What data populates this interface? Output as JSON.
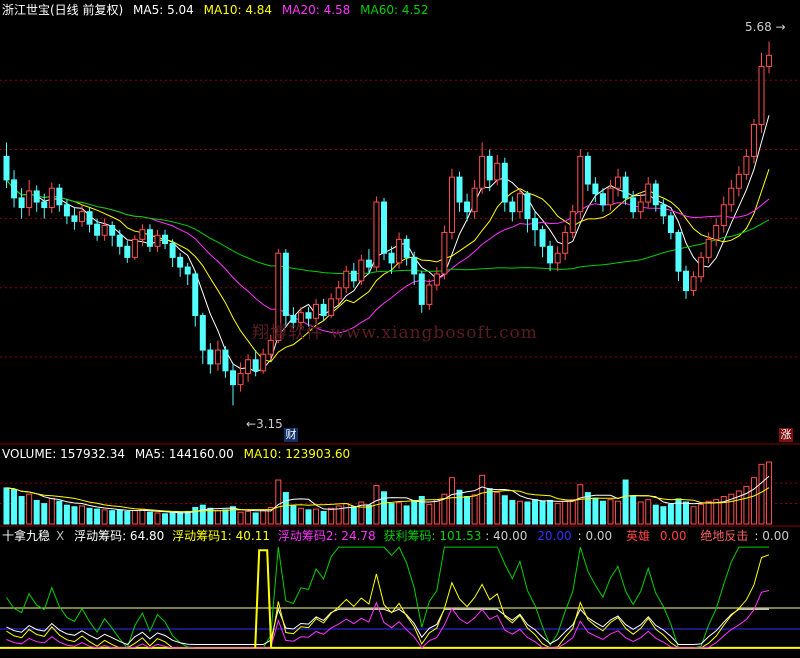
{
  "main_header": {
    "title": "浙江世宝(日线 前复权)",
    "ma5_label": "MA5: 5.04",
    "ma10_label": "MA10: 4.84",
    "ma20_label": "MA20: 4.58",
    "ma60_label": "MA60: 4.52"
  },
  "price_panel": {
    "high_marker": "5.68",
    "low_marker": "3.15",
    "finance_badge": "财",
    "rise_badge": "涨",
    "watermark": "翔博软件 www.xiangbosoft.com"
  },
  "volume_header": {
    "volume_label": "VOLUME: 157932.34",
    "ma5_label": "MA5: 144160.00",
    "ma10_label": "MA10: 123903.60"
  },
  "indicator_header": {
    "name": "十拿九稳",
    "close_mark": "X",
    "float_chip": "浮动筹码: 64.80",
    "float_chip1": "浮动筹码1: 40.11",
    "float_chip2": "浮动筹码2: 24.78",
    "profit_chip": "获利筹码: 101.53",
    "ref_line": ": 40.00",
    "blue_line": "20.00",
    "blue_value": ": 0.00",
    "hero": "英雄",
    "hero_value": "0.00",
    "rebound": "绝地反击",
    "rebound_value": ": 0.00"
  },
  "colors": {
    "up": "#ff4f4f",
    "down": "#54ffff",
    "ma5": "#ffffff",
    "ma10": "#ffff00",
    "ma20": "#ff33ff",
    "ma60": "#00d000",
    "grid": "#8a0000"
  },
  "chart_data": {
    "type": "candlestick",
    "price_ylim": [
      2.9,
      5.95
    ],
    "candles": [
      [
        4.95,
        4.78,
        5.05,
        4.72,
        92000
      ],
      [
        4.78,
        4.65,
        4.85,
        4.58,
        88000
      ],
      [
        4.65,
        4.58,
        4.72,
        4.5,
        70000
      ],
      [
        4.58,
        4.7,
        4.78,
        4.52,
        76000
      ],
      [
        4.7,
        4.62,
        4.74,
        4.55,
        60000
      ],
      [
        4.62,
        4.58,
        4.68,
        4.5,
        52000
      ],
      [
        4.58,
        4.72,
        4.76,
        4.54,
        65000
      ],
      [
        4.72,
        4.6,
        4.75,
        4.55,
        58000
      ],
      [
        4.6,
        4.52,
        4.64,
        4.46,
        48000
      ],
      [
        4.52,
        4.48,
        4.58,
        4.42,
        44000
      ],
      [
        4.48,
        4.55,
        4.6,
        4.44,
        46000
      ],
      [
        4.55,
        4.46,
        4.58,
        4.4,
        40000
      ],
      [
        4.46,
        4.38,
        4.5,
        4.34,
        38000
      ],
      [
        4.38,
        4.45,
        4.5,
        4.34,
        36000
      ],
      [
        4.45,
        4.38,
        4.48,
        4.3,
        34000
      ],
      [
        4.38,
        4.3,
        4.42,
        4.24,
        36000
      ],
      [
        4.3,
        4.22,
        4.34,
        4.18,
        32000
      ],
      [
        4.22,
        4.35,
        4.38,
        4.2,
        34000
      ],
      [
        4.35,
        4.42,
        4.46,
        4.3,
        38000
      ],
      [
        4.42,
        4.3,
        4.46,
        4.26,
        30000
      ],
      [
        4.3,
        4.38,
        4.42,
        4.26,
        28000
      ],
      [
        4.38,
        4.32,
        4.42,
        4.28,
        26000
      ],
      [
        4.32,
        4.22,
        4.35,
        4.15,
        28000
      ],
      [
        4.22,
        4.15,
        4.25,
        4.08,
        30000
      ],
      [
        4.15,
        4.1,
        4.18,
        4.02,
        32000
      ],
      [
        4.1,
        3.8,
        4.12,
        3.72,
        42000
      ],
      [
        3.8,
        3.55,
        3.82,
        3.45,
        48000
      ],
      [
        3.55,
        3.45,
        3.6,
        3.38,
        40000
      ],
      [
        3.45,
        3.55,
        3.62,
        3.4,
        34000
      ],
      [
        3.55,
        3.4,
        3.58,
        3.35,
        36000
      ],
      [
        3.4,
        3.3,
        3.45,
        3.15,
        44000
      ],
      [
        3.3,
        3.38,
        3.46,
        3.25,
        30000
      ],
      [
        3.38,
        3.48,
        3.52,
        3.32,
        32000
      ],
      [
        3.48,
        3.4,
        3.55,
        3.36,
        28000
      ],
      [
        3.4,
        3.52,
        3.56,
        3.38,
        34000
      ],
      [
        3.52,
        3.62,
        3.66,
        3.48,
        42000
      ],
      [
        3.62,
        4.25,
        4.28,
        3.6,
        112000
      ],
      [
        4.25,
        3.8,
        4.28,
        3.72,
        80000
      ],
      [
        3.8,
        3.75,
        3.86,
        3.7,
        46000
      ],
      [
        3.75,
        3.82,
        3.86,
        3.7,
        40000
      ],
      [
        3.82,
        3.78,
        3.86,
        3.72,
        36000
      ],
      [
        3.78,
        3.88,
        3.92,
        3.74,
        38000
      ],
      [
        3.88,
        3.8,
        3.92,
        3.76,
        32000
      ],
      [
        3.8,
        3.92,
        3.96,
        3.78,
        40000
      ],
      [
        3.92,
        4.0,
        4.05,
        3.88,
        46000
      ],
      [
        4.0,
        4.12,
        4.16,
        3.96,
        52000
      ],
      [
        4.12,
        4.05,
        4.18,
        4.0,
        44000
      ],
      [
        4.05,
        4.2,
        4.24,
        4.02,
        56000
      ],
      [
        4.2,
        4.15,
        4.28,
        4.1,
        48000
      ],
      [
        4.15,
        4.62,
        4.66,
        4.12,
        98000
      ],
      [
        4.62,
        4.25,
        4.65,
        4.2,
        82000
      ],
      [
        4.25,
        4.18,
        4.3,
        4.1,
        52000
      ],
      [
        4.18,
        4.35,
        4.4,
        4.14,
        54000
      ],
      [
        4.35,
        4.22,
        4.38,
        4.16,
        46000
      ],
      [
        4.22,
        4.1,
        4.26,
        4.02,
        60000
      ],
      [
        4.1,
        3.88,
        4.12,
        3.82,
        70000
      ],
      [
        3.88,
        4.02,
        4.06,
        3.84,
        50000
      ],
      [
        4.02,
        4.1,
        4.15,
        3.98,
        62000
      ],
      [
        4.1,
        4.4,
        4.45,
        4.06,
        76000
      ],
      [
        4.4,
        4.8,
        4.86,
        4.35,
        118000
      ],
      [
        4.8,
        4.62,
        4.84,
        4.55,
        86000
      ],
      [
        4.62,
        4.55,
        4.68,
        4.48,
        70000
      ],
      [
        4.55,
        4.72,
        4.78,
        4.5,
        74000
      ],
      [
        4.72,
        4.95,
        5.05,
        4.68,
        124000
      ],
      [
        4.95,
        4.78,
        5.0,
        4.7,
        90000
      ],
      [
        4.78,
        4.9,
        4.96,
        4.74,
        80000
      ],
      [
        4.9,
        4.62,
        4.94,
        4.55,
        72000
      ],
      [
        4.62,
        4.55,
        4.66,
        4.48,
        60000
      ],
      [
        4.55,
        4.68,
        4.72,
        4.5,
        58000
      ],
      [
        4.68,
        4.5,
        4.7,
        4.4,
        56000
      ],
      [
        4.5,
        4.42,
        4.55,
        4.3,
        62000
      ],
      [
        4.42,
        4.3,
        4.45,
        4.22,
        58000
      ],
      [
        4.3,
        4.18,
        4.34,
        4.12,
        60000
      ],
      [
        4.18,
        4.25,
        4.3,
        4.12,
        52000
      ],
      [
        4.25,
        4.4,
        4.45,
        4.2,
        58000
      ],
      [
        4.4,
        4.55,
        4.6,
        4.36,
        62000
      ],
      [
        4.55,
        4.95,
        5.0,
        4.5,
        100000
      ],
      [
        4.95,
        4.75,
        4.98,
        4.7,
        80000
      ],
      [
        4.75,
        4.68,
        4.8,
        4.62,
        66000
      ],
      [
        4.68,
        4.6,
        4.72,
        4.55,
        58000
      ],
      [
        4.6,
        4.72,
        4.78,
        4.56,
        62000
      ],
      [
        4.72,
        4.8,
        4.86,
        4.66,
        58000
      ],
      [
        4.8,
        4.65,
        4.84,
        4.6,
        112000
      ],
      [
        4.65,
        4.55,
        4.7,
        4.5,
        70000
      ],
      [
        4.55,
        4.62,
        4.68,
        4.5,
        56000
      ],
      [
        4.62,
        4.75,
        4.8,
        4.58,
        62000
      ],
      [
        4.75,
        4.6,
        4.78,
        4.55,
        48000
      ],
      [
        4.6,
        4.52,
        4.64,
        4.46,
        44000
      ],
      [
        4.52,
        4.4,
        4.55,
        4.35,
        50000
      ],
      [
        4.4,
        4.12,
        4.42,
        4.05,
        64000
      ],
      [
        4.12,
        3.98,
        4.16,
        3.92,
        56000
      ],
      [
        3.98,
        4.08,
        4.12,
        3.94,
        44000
      ],
      [
        4.08,
        4.22,
        4.26,
        4.04,
        50000
      ],
      [
        4.22,
        4.35,
        4.4,
        4.18,
        58000
      ],
      [
        4.35,
        4.45,
        4.5,
        4.3,
        62000
      ],
      [
        4.45,
        4.6,
        4.66,
        4.4,
        70000
      ],
      [
        4.6,
        4.72,
        4.78,
        4.55,
        76000
      ],
      [
        4.72,
        4.82,
        4.88,
        4.66,
        84000
      ],
      [
        4.82,
        4.95,
        5.0,
        4.78,
        96000
      ],
      [
        4.95,
        5.18,
        5.22,
        4.9,
        118000
      ],
      [
        5.18,
        5.6,
        5.7,
        5.12,
        152000
      ],
      [
        5.6,
        5.68,
        5.78,
        5.55,
        157932
      ]
    ],
    "indicator_ylim": [
      0,
      100
    ],
    "indicator_ref": 40,
    "indicator_blue": 20
  }
}
